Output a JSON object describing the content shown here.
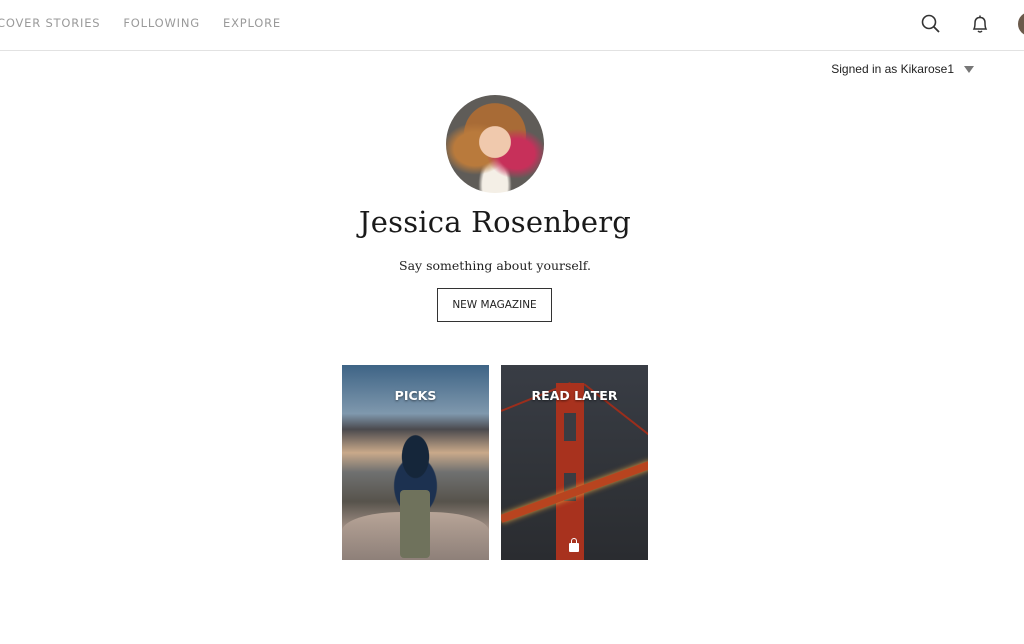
{
  "nav": {
    "items": [
      {
        "label": "COVER STORIES"
      },
      {
        "label": "FOLLOWING"
      },
      {
        "label": "EXPLORE"
      }
    ],
    "icons": [
      "search-icon",
      "bell-icon",
      "avatar"
    ]
  },
  "account": {
    "signed_in_text": "Signed in as Kikarose1"
  },
  "profile": {
    "name": "Jessica Rosenberg",
    "bio_placeholder": "Say something about yourself.",
    "new_magazine_label": "NEW MAGAZINE"
  },
  "magazines": [
    {
      "title": "PICKS",
      "private": false
    },
    {
      "title": "READ LATER",
      "private": true
    }
  ]
}
